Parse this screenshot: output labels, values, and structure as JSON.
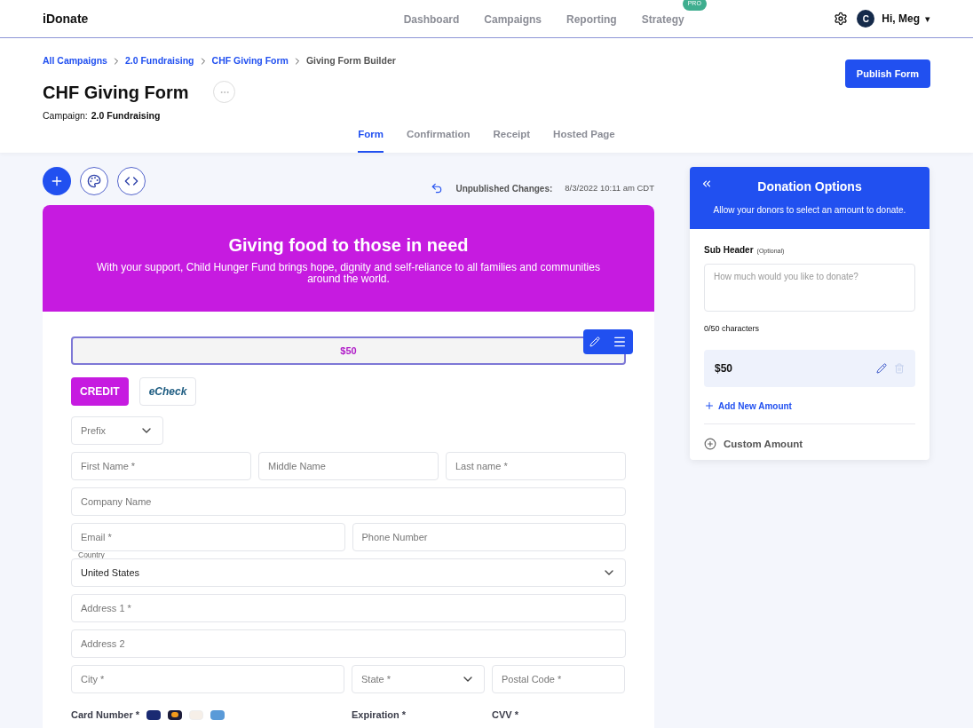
{
  "brand": "iDonate",
  "nav": [
    {
      "label": "Dashboard",
      "selected": false
    },
    {
      "label": "Campaigns",
      "selected": false
    },
    {
      "label": "Reporting",
      "selected": false
    },
    {
      "label": "Strategy",
      "selected": false,
      "badge": "PRO"
    }
  ],
  "user": {
    "avatar": "C",
    "greeting": "Hi, Meg",
    "caret": "▾"
  },
  "breadcrumbs": [
    {
      "label": "All Campaigns",
      "link": true
    },
    {
      "label": "2.0 Fundraising",
      "link": true
    },
    {
      "label": "CHF Giving Form",
      "link": true
    },
    {
      "label": "Giving Form Builder",
      "link": false
    }
  ],
  "title": "CHF Giving Form",
  "campaign": {
    "label": "Campaign:",
    "value": "2.0 Fundraising"
  },
  "publish_button": "Publish Form",
  "tabs": [
    {
      "label": "Form",
      "selected": true
    },
    {
      "label": "Confirmation",
      "selected": false
    },
    {
      "label": "Receipt",
      "selected": false
    },
    {
      "label": "Hosted Page",
      "selected": false
    }
  ],
  "status": {
    "label": "Unpublished Changes:",
    "value": "8/3/2022 10:11 am CDT"
  },
  "banner": {
    "title": "Giving food to those in need",
    "text": "With your support, Child Hunger Fund brings hope, dignity and self-reliance to all families and communities around the world."
  },
  "amount_button": "$50",
  "payment_methods": [
    {
      "label": "CREDIT",
      "selected": true
    },
    {
      "label": "eCheck",
      "selected": false
    }
  ],
  "form_rows": [
    [
      {
        "kind": "select",
        "placeholder": "Prefix"
      }
    ],
    [
      {
        "kind": "text",
        "placeholder": "First Name *"
      },
      {
        "kind": "text",
        "placeholder": "Middle Name"
      },
      {
        "kind": "text",
        "placeholder": "Last name *"
      }
    ],
    [
      {
        "kind": "text",
        "placeholder": "Company Name"
      }
    ],
    [
      {
        "kind": "text",
        "placeholder": "Email *"
      },
      {
        "kind": "text",
        "placeholder": "Phone Number"
      }
    ],
    [
      {
        "kind": "select",
        "label": "Country",
        "value": "United States"
      }
    ],
    [
      {
        "kind": "text",
        "placeholder": "Address 1 *"
      }
    ],
    [
      {
        "kind": "text",
        "placeholder": "Address 2"
      }
    ],
    [
      {
        "kind": "text",
        "placeholder": "City *"
      },
      {
        "kind": "select",
        "placeholder": "State *"
      },
      {
        "kind": "text",
        "placeholder": "Postal Code *"
      }
    ]
  ],
  "card_labels": [
    "Card Number *",
    "Expiration *",
    "CVV *"
  ],
  "panel": {
    "title": "Donation Options",
    "subtitle": "Allow your donors to select an amount to donate.",
    "sub_header_label": "Sub Header",
    "optional": "(Optional)",
    "placeholder": "How much would you like to donate?",
    "counter": "0/50 characters",
    "amounts": [
      "$50"
    ],
    "add_amount": "Add New Amount",
    "custom_amount": "Custom Amount"
  }
}
